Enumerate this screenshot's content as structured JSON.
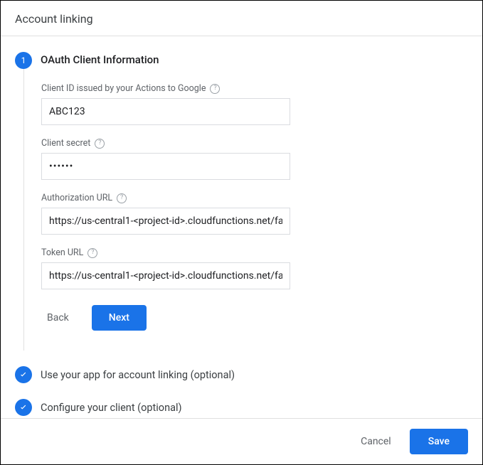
{
  "header": {
    "title": "Account linking"
  },
  "step1": {
    "number": "1",
    "title": "OAuth Client Information",
    "fields": {
      "client_id": {
        "label": "Client ID issued by your Actions to Google",
        "value": "ABC123"
      },
      "client_secret": {
        "label": "Client secret",
        "value": "••••••"
      },
      "auth_url": {
        "label": "Authorization URL",
        "value": "https://us-central1-<project-id>.cloudfunctions.net/fa"
      },
      "token_url": {
        "label": "Token URL",
        "value": "https://us-central1-<project-id>.cloudfunctions.net/fa"
      }
    },
    "back_label": "Back",
    "next_label": "Next"
  },
  "step2": {
    "title": "Use your app for account linking (optional)"
  },
  "step3": {
    "title": "Configure your client (optional)"
  },
  "footer": {
    "cancel": "Cancel",
    "save": "Save"
  }
}
